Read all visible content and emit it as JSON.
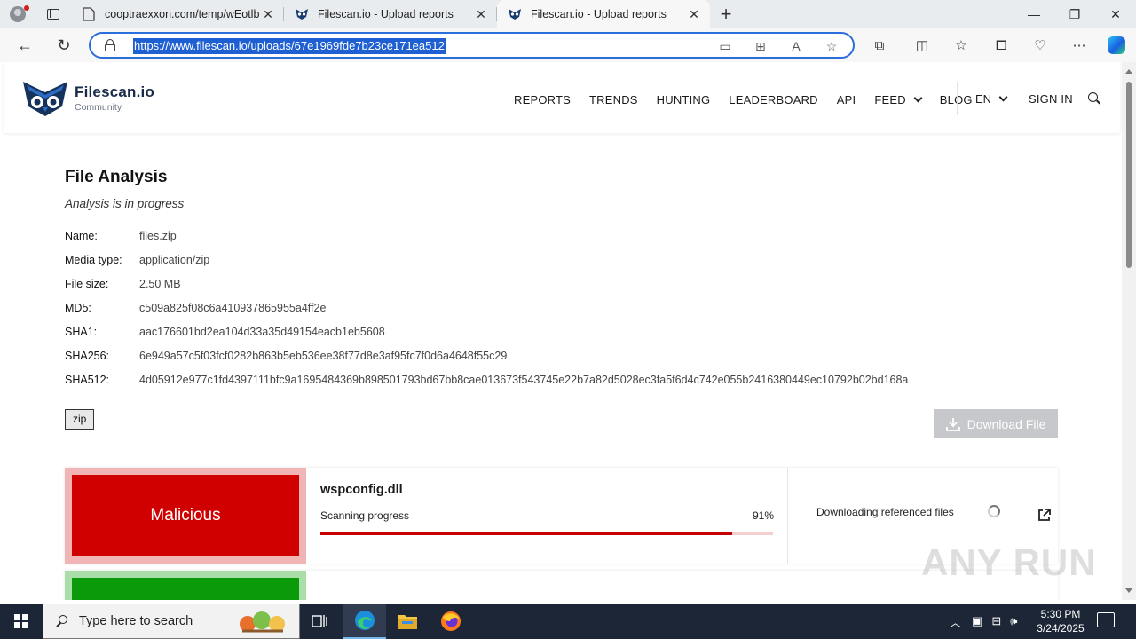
{
  "browser": {
    "tabs": [
      {
        "title": "cooptraexxon.com/temp/wEotlb",
        "active": false
      },
      {
        "title": "Filescan.io - Upload reports",
        "active": false
      },
      {
        "title": "Filescan.io - Upload reports",
        "active": true
      }
    ],
    "url": "https://www.filescan.io/uploads/67e1969fde7b23ce171ea512",
    "icons": [
      "back-icon",
      "refresh-icon",
      "lock-icon",
      "app-available-icon",
      "qr-icon",
      "read-aloud-icon",
      "favorite-star-icon",
      "extensions-icon",
      "split-screen-icon",
      "favorites-icon",
      "collections-icon",
      "browser-essentials-icon",
      "more-icon",
      "copilot-icon"
    ]
  },
  "site": {
    "brand": "Filescan.io",
    "brand_sub": "Community",
    "nav": [
      "REPORTS",
      "TRENDS",
      "HUNTING",
      "LEADERBOARD",
      "API",
      "FEED",
      "BLOG"
    ],
    "lang": "EN",
    "signin": "SIGN IN"
  },
  "analysis": {
    "title": "File Analysis",
    "status": "Analysis is in progress",
    "fields": [
      {
        "label": "Name:",
        "value": "files.zip"
      },
      {
        "label": "Media type:",
        "value": "application/zip"
      },
      {
        "label": "File size:",
        "value": "2.50 MB"
      },
      {
        "label": "MD5:",
        "value": "c509a825f08c6a410937865955a4ff2e"
      },
      {
        "label": "SHA1:",
        "value": "aac176601bd2ea104d33a35d49154eacb1eb5608"
      },
      {
        "label": "SHA256:",
        "value": "6e949a57c5f03fcf0282b863b5eb536ee38f77d8e3af95fc7f0d6a4648f55c29"
      },
      {
        "label": "SHA512:",
        "value": "4d05912e977c1fd4397111bfc9a1695484369b898501793bd67bb8cae013673f543745e22b7a82d5028ec3fa5f6d4c742e055b2416380449ec10792b02bd168a"
      }
    ],
    "tag": "zip",
    "download_label": "Download File"
  },
  "results": [
    {
      "verdict": "Malicious",
      "verdict_color": "#d10000",
      "filename": "wspconfig.dll",
      "progress_label": "Scanning progress",
      "progress_text": "91%",
      "progress": 0.91,
      "referenced": "Downloading referenced files"
    }
  ],
  "watermark": "ANY RUN",
  "taskbar": {
    "search_placeholder": "Type here to search",
    "time": "5:30 PM",
    "date": "3/24/2025"
  }
}
